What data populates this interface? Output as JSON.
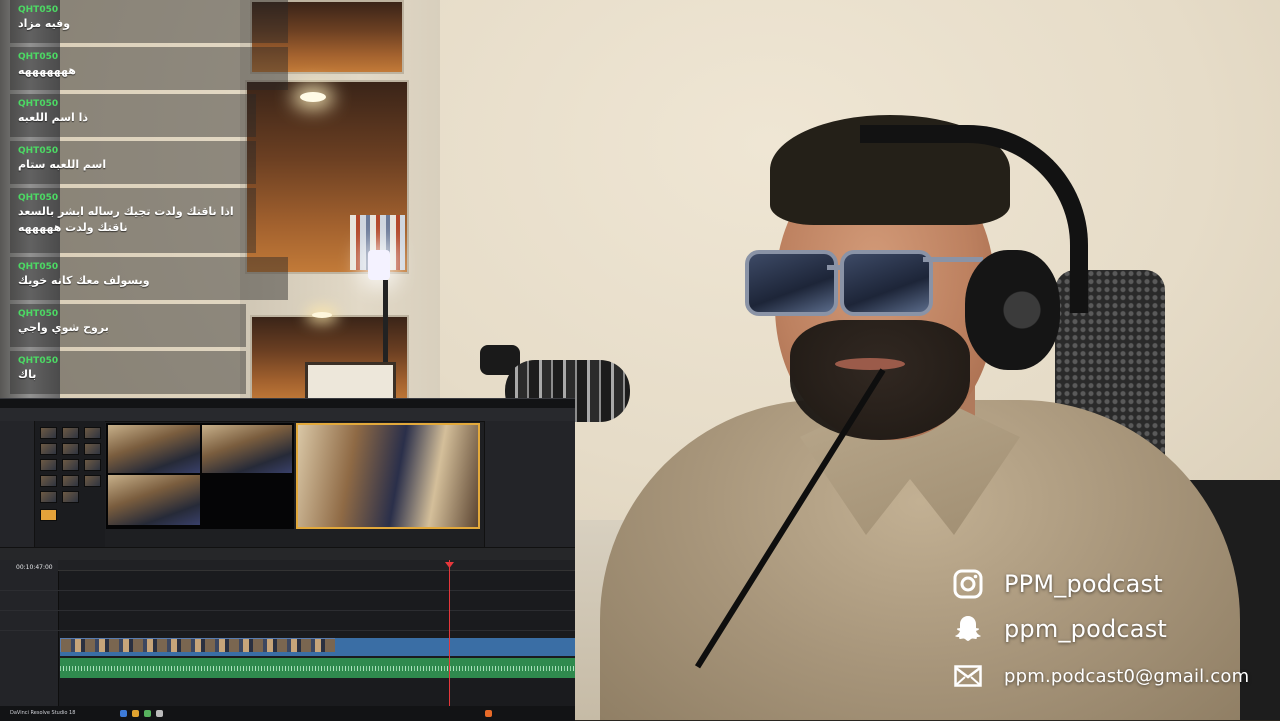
{
  "chat": {
    "messages": [
      {
        "user": "QHT050",
        "text": "وفيه مزاد"
      },
      {
        "user": "QHT050",
        "text": "هههههههه"
      },
      {
        "user": "QHT050",
        "text": "ذا اسم اللعبه"
      },
      {
        "user": "QHT050",
        "text": "اسم اللعبه ستام"
      },
      {
        "user": "QHT050",
        "text": "اذا ناقتك ولدت تجيك رساله ابشر بالسعد ناقتك ولدت هههههه"
      },
      {
        "user": "QHT050",
        "text": "ويسولف معك كانه خويك"
      },
      {
        "user": "QHT050",
        "text": "بروح شوي واجي"
      },
      {
        "user": "QHT050",
        "text": "باك"
      }
    ]
  },
  "socials": {
    "instagram": {
      "icon": "instagram-icon",
      "label": "PPM_podcast"
    },
    "snapchat": {
      "icon": "snapchat-icon",
      "label": "ppm_podcast"
    },
    "email": {
      "icon": "mail-icon",
      "label": "ppm.podcast0@gmail.com"
    }
  },
  "editor": {
    "timecode": "00:10:47:00",
    "app_label": "DaVinci Resolve Studio 18"
  },
  "colors": {
    "chat_user": "#4cd964",
    "accent_orange": "#e3a93b",
    "playhead": "#e5373b",
    "video_clip": "#3a6ea5",
    "audio_clip": "#2f8a4e"
  }
}
